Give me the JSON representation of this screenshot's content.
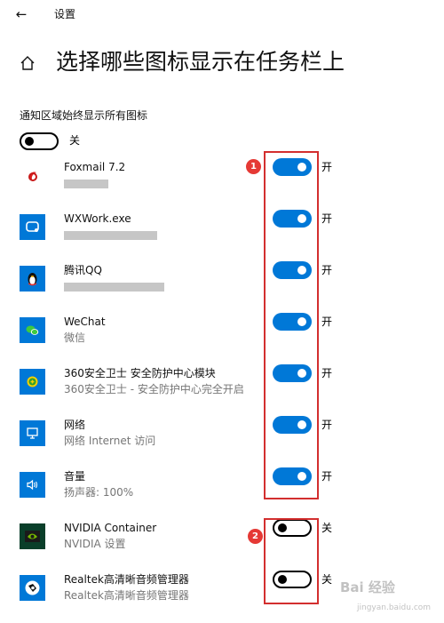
{
  "header": {
    "back_glyph": "←",
    "crumb": "设置"
  },
  "page_title": "选择哪些图标显示在任务栏上",
  "notify": {
    "label": "通知区域始终显示所有图标",
    "state": "关",
    "on": false
  },
  "accent_color": "#0078d7",
  "annotation_color": "#d32f2f",
  "apps": [
    {
      "name": "Foxmail 7.2",
      "sub": "",
      "icon": "foxmail-icon",
      "on": true,
      "state": "开"
    },
    {
      "name": "WXWork.exe",
      "sub": "",
      "icon": "wxwork-icon",
      "on": true,
      "state": "开"
    },
    {
      "name": "腾讯QQ",
      "sub": "",
      "icon": "qq-penguin-icon",
      "on": true,
      "state": "开"
    },
    {
      "name": "WeChat",
      "sub": "微信",
      "icon": "wechat-icon",
      "on": true,
      "state": "开"
    },
    {
      "name": "360安全卫士 安全防护中心模块",
      "sub": "360安全卫士 - 安全防护中心完全开启",
      "icon": "360-shield-icon",
      "on": true,
      "state": "开"
    },
    {
      "name": "网络",
      "sub": "网络 Internet 访问",
      "icon": "network-monitor-icon",
      "on": true,
      "state": "开"
    },
    {
      "name": "音量",
      "sub": "扬声器: 100%",
      "icon": "speaker-volume-icon",
      "on": true,
      "state": "开"
    },
    {
      "name": "NVIDIA Container",
      "sub": "NVIDIA 设置",
      "icon": "nvidia-icon",
      "on": false,
      "state": "关"
    },
    {
      "name": "Realtek高清晰音频管理器",
      "sub": "Realtek高清晰音频管理器",
      "icon": "realtek-speaker-icon",
      "on": false,
      "state": "关"
    }
  ],
  "annotations": [
    {
      "label": "1"
    },
    {
      "label": "2"
    }
  ],
  "watermark": {
    "main": "Bai 经验",
    "sub": "jingyan.baidu.com"
  }
}
